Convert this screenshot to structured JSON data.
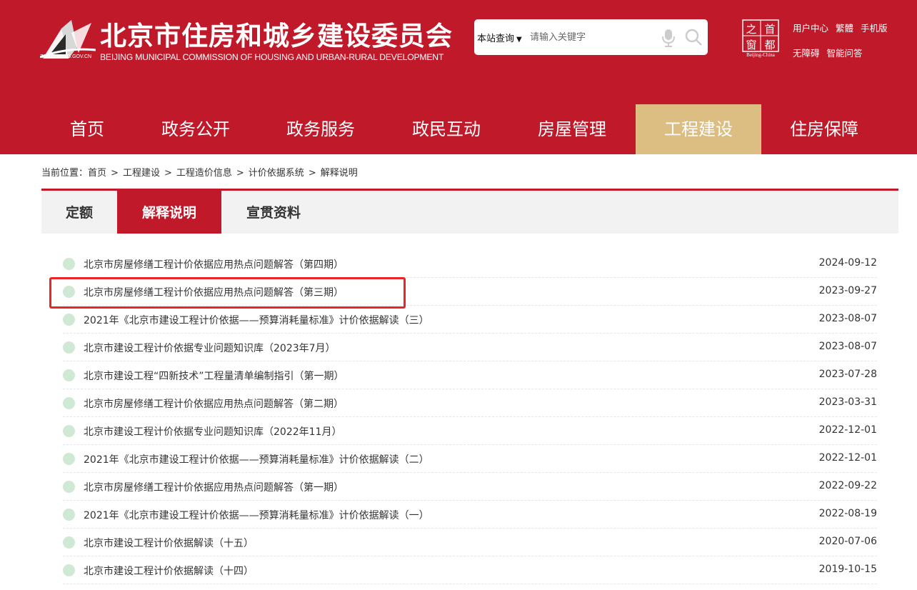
{
  "header": {
    "logo_url_text": "ZJW.BEIJING.GOV.CN",
    "title": "北京市住房和城乡建设委员会",
    "subtitle": "BEIJING MUNICIPAL COMMISSION OF HOUSING AND URBAN-RURAL DEVELOPMENT",
    "search": {
      "scope": "本站查询",
      "placeholder": "请输入关键字"
    },
    "capital_logo": {
      "chars": [
        "之",
        "首",
        "窗",
        "都"
      ],
      "caption": "Beijing-China"
    },
    "toplinks": {
      "row1": [
        "用户中心",
        "繁體",
        "手机版"
      ],
      "row2": [
        "无障碍",
        "智能问答"
      ]
    }
  },
  "nav": [
    "首页",
    "政务公开",
    "政务服务",
    "政民互动",
    "房屋管理",
    "工程建设",
    "住房保障"
  ],
  "nav_active_index": 5,
  "breadcrumb": {
    "prefix": "当前位置：",
    "items": [
      "首页",
      "工程建设",
      "工程造价信息",
      "计价依据系统",
      "解释说明"
    ],
    "separator": ">"
  },
  "tabs": [
    "定额",
    "解释说明",
    "宣贯资料"
  ],
  "tabs_active_index": 1,
  "list": [
    {
      "title": "北京市房屋修缮工程计价依据应用热点问题解答（第四期）",
      "date": "2024-09-12"
    },
    {
      "title": "北京市房屋修缮工程计价依据应用热点问题解答（第三期）",
      "date": "2023-09-27"
    },
    {
      "title": "2021年《北京市建设工程计价依据——预算消耗量标准》计价依据解读（三）",
      "date": "2023-08-07"
    },
    {
      "title": "北京市建设工程计价依据专业问题知识库（2023年7月）",
      "date": "2023-08-07"
    },
    {
      "title": "北京市建设工程“四新技术”工程量清单编制指引（第一期）",
      "date": "2023-07-28"
    },
    {
      "title": "北京市房屋修缮工程计价依据应用热点问题解答（第二期）",
      "date": "2023-03-31"
    },
    {
      "title": "北京市建设工程计价依据专业问题知识库（2022年11月）",
      "date": "2022-12-01"
    },
    {
      "title": "2021年《北京市建设工程计价依据——预算消耗量标准》计价依据解读（二）",
      "date": "2022-12-01"
    },
    {
      "title": "北京市房屋修缮工程计价依据应用热点问题解答（第一期）",
      "date": "2022-09-22"
    },
    {
      "title": "2021年《北京市建设工程计价依据——预算消耗量标准》计价依据解读（一）",
      "date": "2022-08-19"
    },
    {
      "title": "北京市建设工程计价依据解读（十五）",
      "date": "2020-07-06"
    },
    {
      "title": "北京市建设工程计价依据解读（十四）",
      "date": "2019-10-15"
    }
  ],
  "colors": {
    "brand_red": "#c0192a",
    "active_nav_gold": "#dcbd82",
    "highlight_border": "#e8262a",
    "dot_green": "#cfe9d5"
  }
}
